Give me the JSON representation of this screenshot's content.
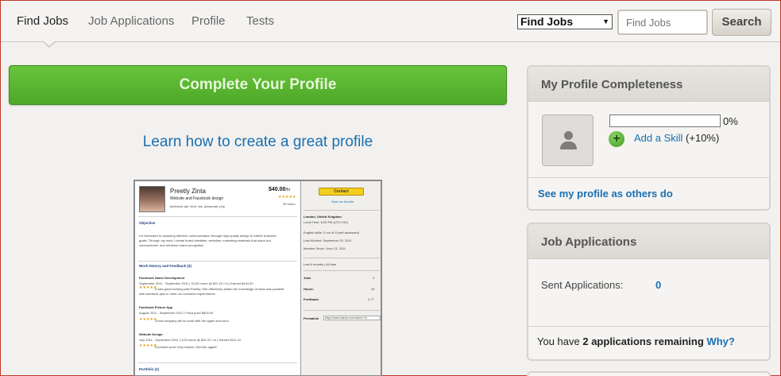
{
  "nav": {
    "tabs": [
      {
        "label": "Find Jobs",
        "active": true
      },
      {
        "label": "Job Applications",
        "active": false
      },
      {
        "label": "Profile",
        "active": false
      },
      {
        "label": "Tests",
        "active": false
      }
    ],
    "search_scope": "Find Jobs",
    "search_placeholder": "Find Jobs",
    "search_button": "Search"
  },
  "main": {
    "cta_label": "Complete Your Profile",
    "learn_link": "Learn how to create a great profile",
    "preview": {
      "name": "Preetly Zinta",
      "title": "Website and Facebook design",
      "skills": "facebook-api, html, css, javascript, php",
      "rate": "$40.00",
      "rate_unit": "/hr",
      "hours": "30 hours",
      "objective_heading": "Objective",
      "objective_text": [
        "I'm interested in capturing effective communication through high-quality design to further business",
        "goals. Through my work I create brand identities, websites, marketing materials that stand out,",
        "communicate, and reinforce brand recognition."
      ],
      "history_heading": "Work History and Feedback (3)",
      "jobs": [
        {
          "title": "Facebook Game Development",
          "meta": "September 2011 - September 2011  |  30.00 hours @ $22.22 / hr  |  Earned $444.40",
          "feedback": "It was great working with Preetly. She effectively added her knowledge of what was possible",
          "feedback2": "with facebook apis to meet our business requirements."
        },
        {
          "title": "Facebook Picture App",
          "meta": "August 2011 - September 2011  |  Fixed price $800.00",
          "feedback": "Great company will do work with her again and soon."
        },
        {
          "title": "Website Design",
          "meta": "July 2011 - September 2011  |  3.00 hours @ $22.22 / hr  |  Earned $111.10",
          "feedback": "Excellent work! Very helpful. Will hire again!!"
        }
      ],
      "portfolio_heading": "Portfolio (1)",
      "contact_button": "Contact",
      "save_favorite": "Save as favorite",
      "location": "London, United Kingdom",
      "local_time": "Local Time: 6:25 PM (UTC+00:)",
      "english_skills": "English skills:  5 out of 5 (self-assessed)",
      "last_worked": "Last Worked:  September 25, 2011",
      "member_since": "Member Since:  June 13, 2011",
      "period": "Last 6 months  |  All time",
      "stats": [
        {
          "label": "Jobs",
          "value": "3"
        },
        {
          "label": "Hours:",
          "value": "25"
        },
        {
          "label": "Feedback:",
          "value": "4.77"
        }
      ],
      "permalink_label": "Permalink",
      "permalink_value": "https://www.elance.com/users/~01"
    }
  },
  "completeness": {
    "title": "My Profile Completeness",
    "percent": 0,
    "percent_label": "0%",
    "add_skill_label": "Add a Skill",
    "add_skill_gain": "(+10%)",
    "see_profile_link": "See my profile as others do"
  },
  "applications": {
    "title": "Job Applications",
    "sent_label": "Sent Applications:",
    "sent_count": "0",
    "remaining_prefix": "You have ",
    "remaining_count": "2 applications remaining",
    "why_link": "Why?"
  },
  "colors": {
    "accent_green": "#5fb234",
    "link_blue": "#1a6fb0",
    "page_bg": "#f2f1ef"
  }
}
